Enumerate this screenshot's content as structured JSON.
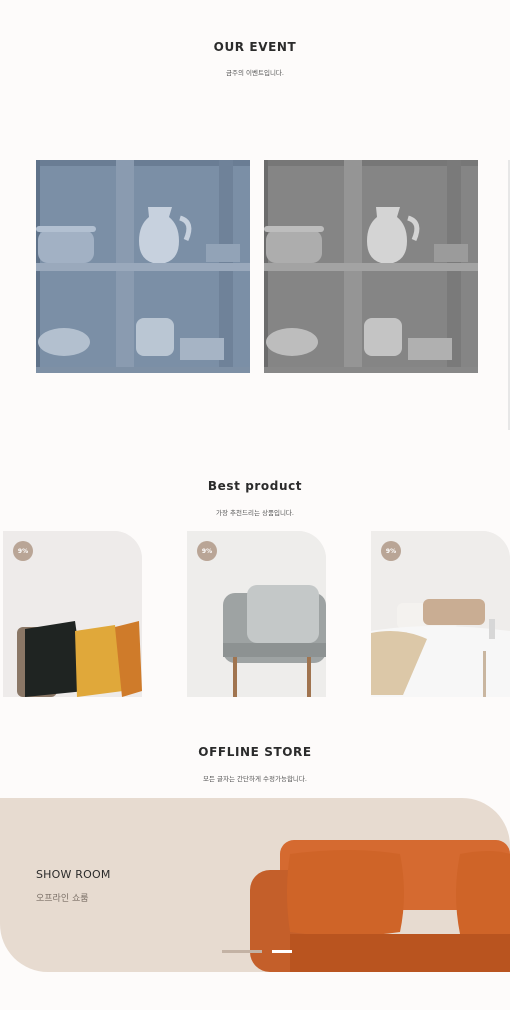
{
  "event": {
    "title": "OUR EVENT",
    "subtitle": "금주의 이벤트입니다."
  },
  "best": {
    "title": "Best product",
    "subtitle": "가장 추천드리는 상품입니다.",
    "products": [
      {
        "badge": "9%"
      },
      {
        "badge": "9%"
      },
      {
        "badge": "9%"
      }
    ]
  },
  "offline": {
    "title": "OFFLINE STORE",
    "subtitle": "모든 글자는 간단하게 수정가능합니다.",
    "showroom_title": "SHOW ROOM",
    "showroom_sub": "오프라인 쇼룸"
  },
  "colors": {
    "badge": "#b9a596",
    "showroom_bg": "#e7dbd0",
    "sofa": "#c45f2a"
  }
}
